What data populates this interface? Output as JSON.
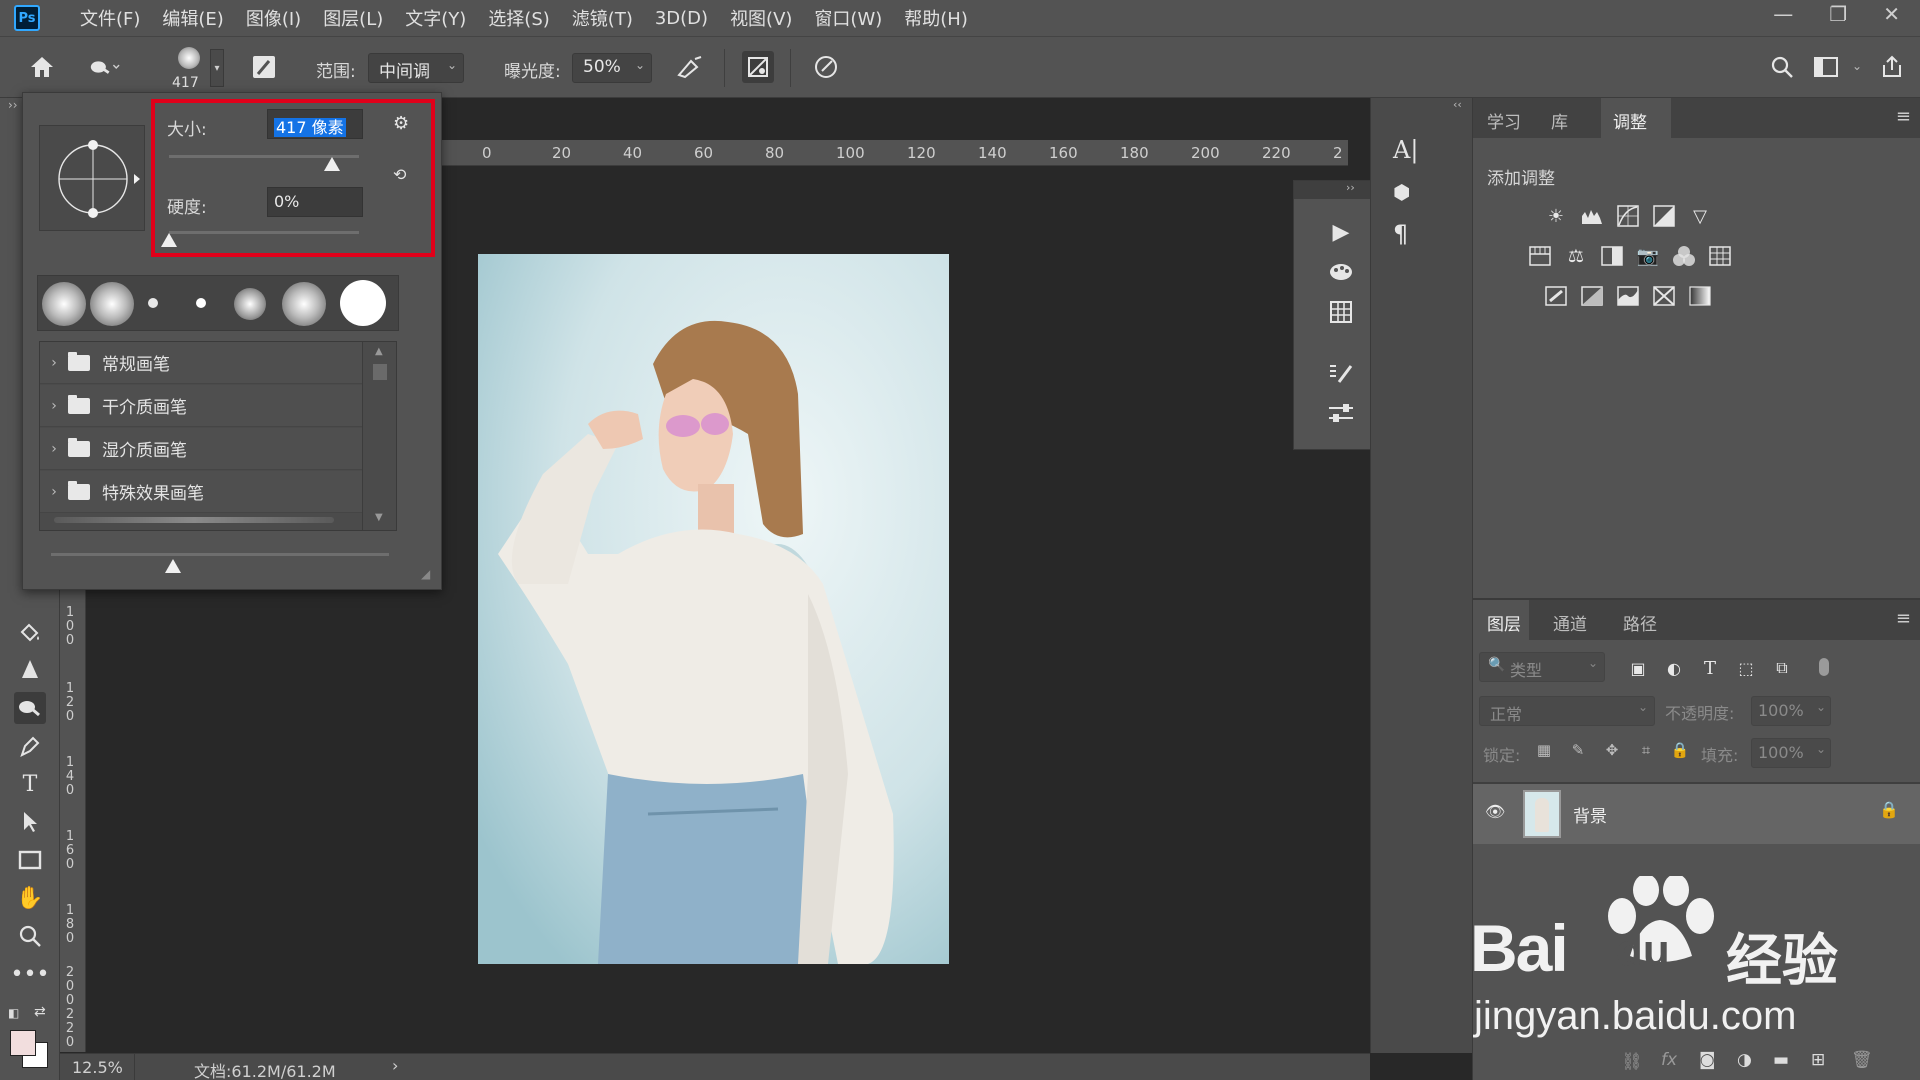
{
  "app": {
    "logo": "Ps",
    "menu": [
      "文件(F)",
      "编辑(E)",
      "图像(I)",
      "图层(L)",
      "文字(Y)",
      "选择(S)",
      "滤镜(T)",
      "3D(D)",
      "视图(V)",
      "窗口(W)",
      "帮助(H)"
    ],
    "window_controls": [
      "minimize-icon",
      "restore-icon",
      "close-icon"
    ]
  },
  "options_bar": {
    "brush_size": "417",
    "range_label": "范围:",
    "range_value": "中间调",
    "exposure_label": "曝光度:",
    "exposure_value": "50%"
  },
  "brush_popup": {
    "size_label": "大小:",
    "size_value": "417 像素",
    "hardness_label": "硬度:",
    "hardness_value": "0%",
    "folders": [
      "常规画笔",
      "干介质画笔",
      "湿介质画笔",
      "特殊效果画笔"
    ]
  },
  "ruler": {
    "top_ticks": [
      "0",
      "20",
      "40",
      "60",
      "80",
      "100",
      "120",
      "140",
      "160",
      "180",
      "200",
      "220",
      "2"
    ],
    "left_ticks": [
      "1\n0\n0",
      "1\n2\n0",
      "1\n4\n0",
      "1\n6\n0",
      "1\n8\n0",
      "2\n0\n0",
      "2\n2\n0"
    ]
  },
  "adjustments_panel": {
    "tabs": [
      "学习",
      "库",
      "调整"
    ],
    "active_tab": "调整",
    "heading": "添加调整"
  },
  "layers_panel": {
    "tabs": [
      "图层",
      "通道",
      "路径"
    ],
    "active_tab": "图层",
    "filter_placeholder": "类型",
    "blend_mode": "正常",
    "opacity_label": "不透明度:",
    "opacity_value": "100%",
    "lock_label": "锁定:",
    "fill_label": "填充:",
    "fill_value": "100%",
    "layers": [
      {
        "name": "背景",
        "visible": true,
        "locked": true
      }
    ]
  },
  "status_bar": {
    "zoom": "12.5%",
    "doc_info": "文档:61.2M/61.2M"
  },
  "watermark": {
    "brand": "Bai",
    "brand2": "du",
    "cn": "经验",
    "url": "jingyan.baidu.com"
  },
  "colors": {
    "highlight": "#e0001a",
    "ps_blue": "#31a8ff",
    "panel": "#535353",
    "canvas": "#282828"
  }
}
